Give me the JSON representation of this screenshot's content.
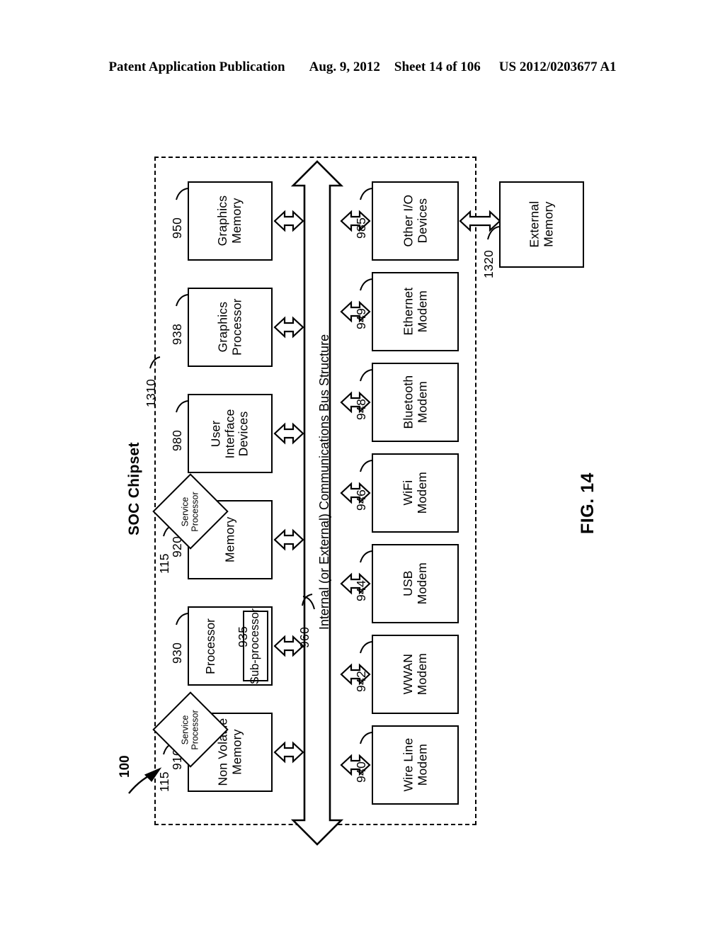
{
  "header": {
    "publication": "Patent Application Publication",
    "date": "Aug. 9, 2012",
    "sheet": "Sheet 14 of 106",
    "patent_number": "US 2012/0203677 A1"
  },
  "figure": {
    "caption": "FIG. 14",
    "overall_ref": "100",
    "soc_title": "SOC Chipset",
    "soc_ref": "1310"
  },
  "bus": {
    "label": "Internal (or External) Communications Bus Structure",
    "ref": "960"
  },
  "left_column": [
    {
      "label": "Graphics\nMemory",
      "ref": "950"
    },
    {
      "label": "Graphics\nProcessor",
      "ref": "938"
    },
    {
      "label": "User\nInterface\nDevices",
      "ref": "980"
    },
    {
      "label": "Memory",
      "ref": "920"
    },
    {
      "label": "Processor",
      "ref": "930"
    },
    {
      "label": "Non Volatile\nMemory",
      "ref": "910"
    }
  ],
  "sub_processor": {
    "label": "Sub-processor",
    "ref": "935"
  },
  "right_column": [
    {
      "label": "Other I/O\nDevices",
      "ref": "985"
    },
    {
      "label": "Ethernet\nModem",
      "ref": "949"
    },
    {
      "label": "Bluetooth\nModem",
      "ref": "948"
    },
    {
      "label": "WiFi\nModem",
      "ref": "946"
    },
    {
      "label": "USB\nModem",
      "ref": "944"
    },
    {
      "label": "WWAN\nModem",
      "ref": "942"
    },
    {
      "label": "Wire Line\nModem",
      "ref": "940"
    }
  ],
  "external": {
    "label": "External\nMemory",
    "ref": "1320"
  },
  "service_processors": [
    {
      "label": "Service\nProcessor",
      "ref": "115"
    },
    {
      "label": "Service\nProcessor",
      "ref": "115"
    }
  ]
}
